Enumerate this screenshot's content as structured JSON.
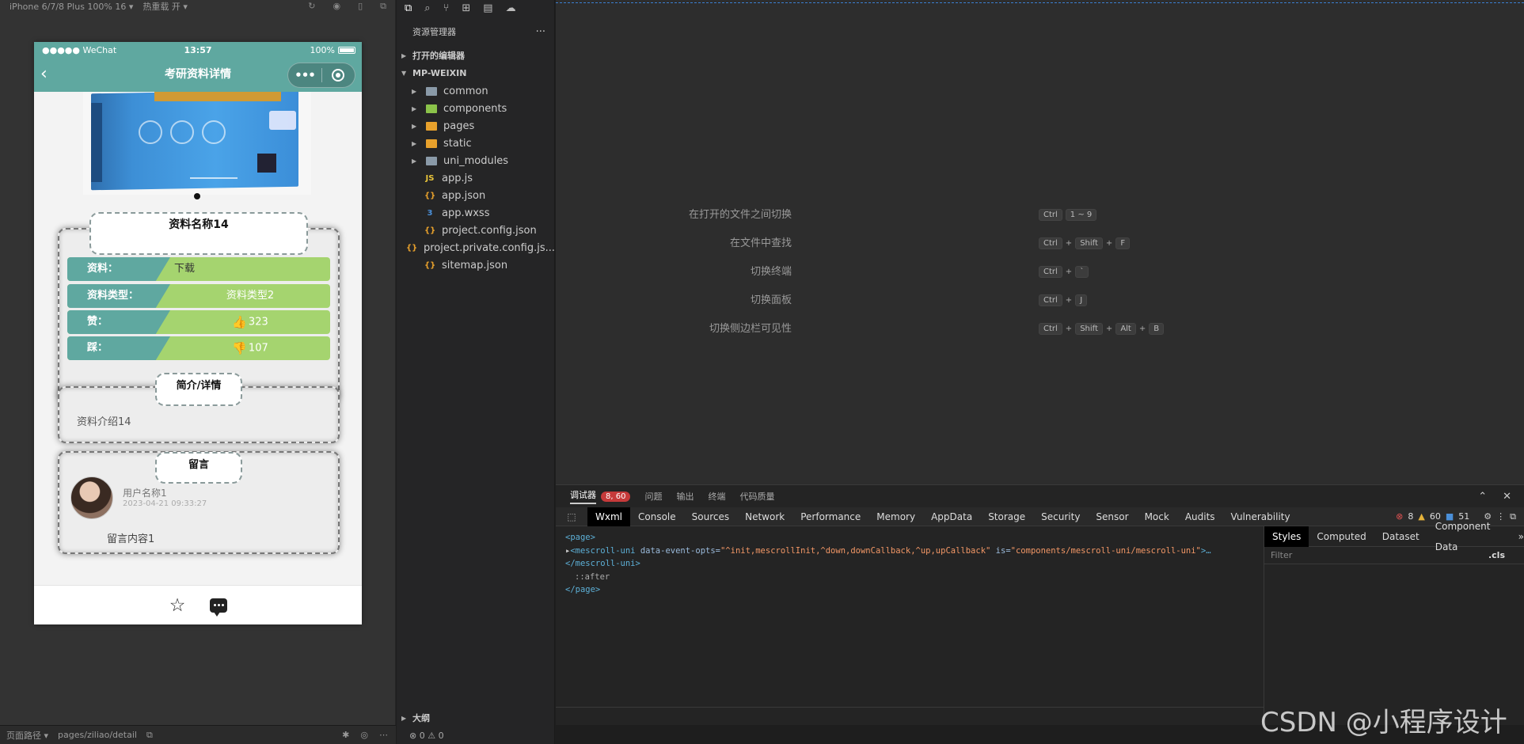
{
  "simulator": {
    "device_label": "iPhone 6/7/8 Plus 100% 16 ▾",
    "hot_reload_label": "热重载 开 ▾",
    "status": {
      "carrier": "●●●●● WeChat",
      "time": "13:57",
      "battery": "100%"
    },
    "nav_title": "考研资料详情",
    "info_title": "资料名称14",
    "rows": [
      {
        "label": "资料：",
        "value": "下载"
      },
      {
        "label": "资料类型：",
        "value": "资料类型2"
      },
      {
        "label": "赞：",
        "value": "323",
        "icon": "thumbs-up-icon"
      },
      {
        "label": "踩：",
        "value": "107",
        "icon": "thumbs-down-icon"
      }
    ],
    "intro_title": "简介/详情",
    "intro_text": "资料介绍14",
    "comment_title": "留言",
    "comment": {
      "user": "用户名称1",
      "time": "2023-04-21 09:33:27",
      "text": "留言内容1"
    },
    "path_label": "页面路径 ▾",
    "path_value": "pages/ziliao/detail"
  },
  "explorer": {
    "title": "资源管理器",
    "open_editors": "打开的编辑器",
    "project": "MP-WEIXIN",
    "folders": [
      "common",
      "components",
      "pages",
      "static",
      "uni_modules"
    ],
    "files": [
      "app.js",
      "app.json",
      "app.wxss",
      "project.config.json",
      "project.private.config.js...",
      "sitemap.json"
    ],
    "outline": "大纲",
    "problems": "⊗ 0 ⚠ 0"
  },
  "editor": {
    "shortcuts": [
      {
        "label": "在打开的文件之间切换",
        "keys": [
          "Ctrl",
          "1 ~ 9"
        ]
      },
      {
        "label": "在文件中查找",
        "keys": [
          "Ctrl",
          "+",
          "Shift",
          "+",
          "F"
        ]
      },
      {
        "label": "切换终端",
        "keys": [
          "Ctrl",
          "+",
          "`"
        ]
      },
      {
        "label": "切换面板",
        "keys": [
          "Ctrl",
          "+",
          "J"
        ]
      },
      {
        "label": "切换侧边栏可见性",
        "keys": [
          "Ctrl",
          "+",
          "Shift",
          "+",
          "Alt",
          "+",
          "B"
        ]
      }
    ]
  },
  "devtools": {
    "top_tabs": [
      "调试器",
      "问题",
      "输出",
      "终端",
      "代码质量"
    ],
    "badge": "8, 60",
    "tabs": [
      "Wxml",
      "Console",
      "Sources",
      "Network",
      "Performance",
      "Memory",
      "AppData",
      "Storage",
      "Security",
      "Sensor",
      "Mock",
      "Audits",
      "Vulnerability"
    ],
    "errors": "8",
    "warnings": "60",
    "infos": "51",
    "wxml": {
      "line1": "<page>",
      "tag_open": "<mescroll-uni",
      "attr1": " data-event-opts=",
      "val1": "\"^init,mescrollInit,^down,downCallback,^up,upCallback\"",
      "attr2": " is=",
      "val2": "\"components/mescroll-uni/mescroll-uni\"",
      "tail": ">…",
      "line3": "</mescroll-uni>",
      "line4": "::after",
      "line5": "</page>"
    },
    "style_tabs": [
      "Styles",
      "Computed",
      "Dataset",
      "Component Data"
    ],
    "filter_placeholder": "Filter",
    "cls": ".cls"
  },
  "watermark": "CSDN @小程序设计"
}
